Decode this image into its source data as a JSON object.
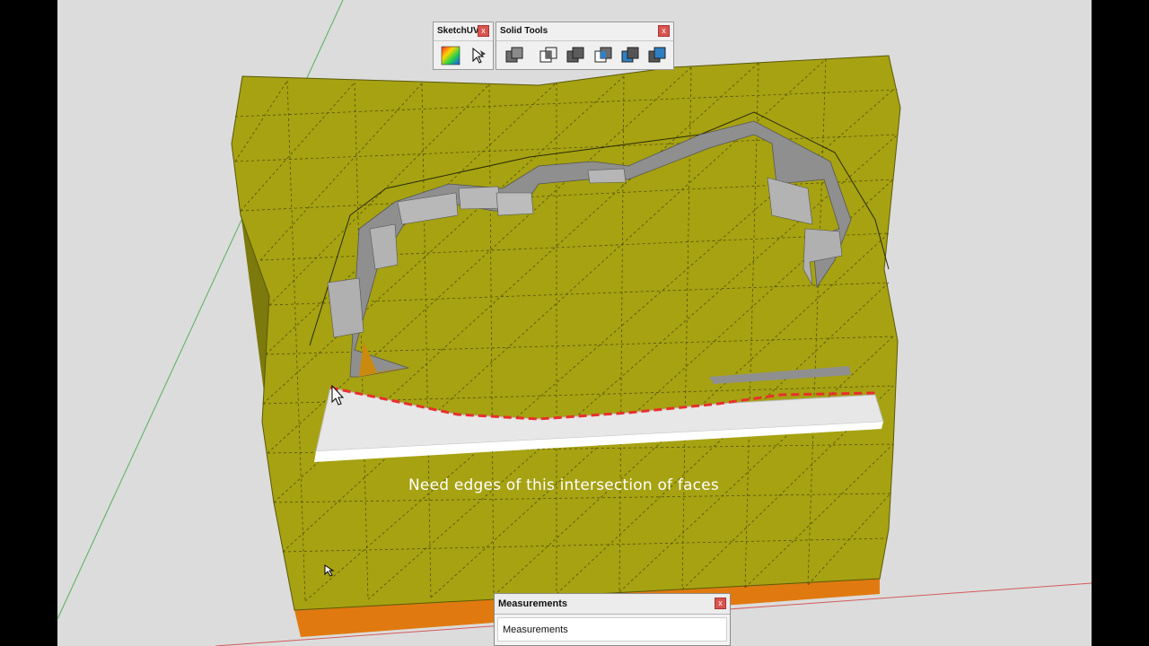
{
  "toolbars": {
    "sketchuv": {
      "title": "SketchUV",
      "close": "x",
      "tools": [
        "uv-gradient-icon",
        "uv-pick-icon"
      ]
    },
    "solid_tools": {
      "title": "Solid Tools",
      "close": "x",
      "tools": [
        "outer-shell-icon",
        "intersect-icon",
        "union-icon",
        "subtract-icon",
        "trim-icon",
        "split-icon"
      ]
    }
  },
  "caption": "Need edges of this intersection of faces",
  "measurements": {
    "title": "Measurements",
    "close": "x",
    "field_label": "Measurements"
  },
  "colors": {
    "terrain": "#a6a212",
    "terrain_side": "#6f6c0b",
    "base_edge": "#e07a10",
    "wall": "#9e9e9e",
    "wall_top": "#c9c9c9",
    "slab": "#e9e9e9",
    "dashed_edge": "#e8302a",
    "background": "#dcdcdc"
  }
}
